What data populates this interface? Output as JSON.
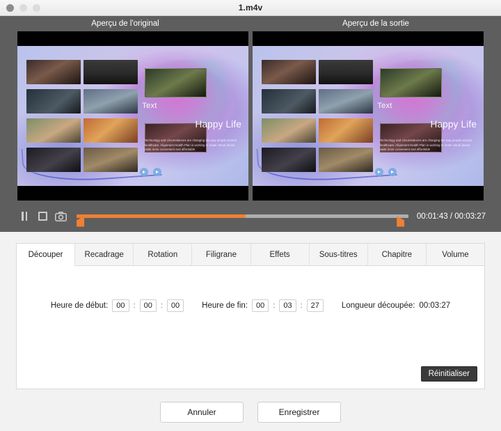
{
  "window": {
    "title": "1.m4v",
    "controls": {
      "close": "close-button",
      "minimize": "minimize-button",
      "zoom": "zoom-button"
    }
  },
  "preview": {
    "original_label": "Aperçu de l'original",
    "output_label": "Aperçu de la sortie",
    "video": {
      "text_overlay": "Text",
      "headline": "Happy Life",
      "body": "Technology and circumstances are changing the way people access healthcare. Alignment Health Plan is working to make virtual doctor visits more convenient and affordable"
    }
  },
  "transport": {
    "pause_icon": "pause-icon",
    "stop_icon": "stop-icon",
    "snapshot_icon": "camera-icon",
    "timecode": "00:01:43 / 00:03:27",
    "current_time": "00:01:43",
    "total_time": "00:03:27",
    "trim_fill_percent": 51,
    "accent_color": "#f08033",
    "track_color": "#aeaeae"
  },
  "tabs": [
    {
      "label": "Découper",
      "active": true
    },
    {
      "label": "Recadrage",
      "active": false
    },
    {
      "label": "Rotation",
      "active": false
    },
    {
      "label": "Filigrane",
      "active": false
    },
    {
      "label": "Effets",
      "active": false
    },
    {
      "label": "Sous-titres",
      "active": false
    },
    {
      "label": "Chapitre",
      "active": false
    },
    {
      "label": "Volume",
      "active": false
    }
  ],
  "trim_panel": {
    "start_label": "Heure de début:",
    "start_hh": "00",
    "start_mm": "00",
    "start_ss": "00",
    "end_label": "Heure de fin:",
    "end_hh": "00",
    "end_mm": "03",
    "end_ss": "27",
    "length_label": "Longueur découpée:",
    "length_value": "00:03:27",
    "separator": ":",
    "reset_label": "Réinitialiser"
  },
  "footer": {
    "cancel_label": "Annuler",
    "save_label": "Enregistrer"
  }
}
